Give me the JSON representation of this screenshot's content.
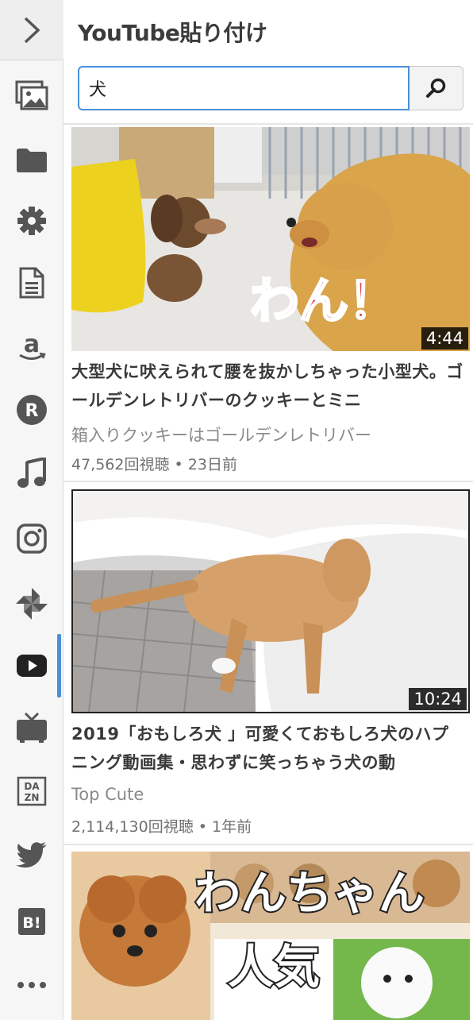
{
  "sidebar": {
    "items": [
      {
        "icon": "images-icon"
      },
      {
        "icon": "folder-icon"
      },
      {
        "icon": "gear-icon"
      },
      {
        "icon": "document-icon"
      },
      {
        "icon": "amazon-icon"
      },
      {
        "icon": "rakuten-icon"
      },
      {
        "icon": "music-note-icon"
      },
      {
        "icon": "instagram-icon"
      },
      {
        "icon": "pinwheel-icon"
      },
      {
        "icon": "youtube-icon"
      },
      {
        "icon": "tv-icon"
      },
      {
        "icon": "dazn-icon"
      },
      {
        "icon": "twitter-icon"
      },
      {
        "icon": "hatena-bookmark-icon"
      },
      {
        "icon": "more-icon"
      }
    ],
    "active": "youtube-icon",
    "dazn_text": "DA\nZN",
    "hatena_text": "B!",
    "rakuten_text": "R",
    "accent": "#4a90d9"
  },
  "panel": {
    "title": "YouTube貼り付け"
  },
  "search": {
    "value": "犬",
    "placeholder": ""
  },
  "videos": [
    {
      "title": "大型犬に吠えられて腰を抜かしちゃった小型犬。ゴールデンレトリバーのクッキーとミニ",
      "channel": "箱入りクッキーはゴールデンレトリバー",
      "meta": "47,562回視聴 • 23日前",
      "duration": "4:44",
      "thumb_caption": "わん！"
    },
    {
      "title": "2019「おもしろ犬 」可愛くておもしろ犬のハプニング動画集・思わずに笑っちゃう犬の動",
      "channel": "Top Cute",
      "meta": "2,114,130回視聴 • 1年前",
      "duration": "10:24"
    },
    {
      "thumb_caption_1": "わんちゃん",
      "thumb_caption_2": "人気"
    }
  ]
}
